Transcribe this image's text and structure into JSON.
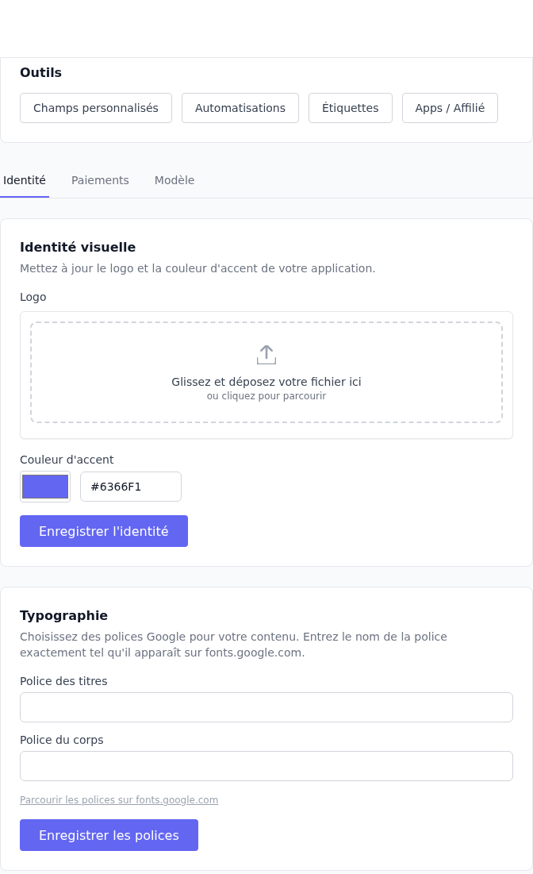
{
  "tools": {
    "title": "Outils",
    "buttons": [
      "Champs personnalisés",
      "Automatisations",
      "Étiquettes",
      "Apps / Affilié"
    ]
  },
  "tabs": [
    {
      "label": "Identité",
      "selected": true
    },
    {
      "label": "Paiements",
      "selected": false
    },
    {
      "label": "Modèle",
      "selected": false
    }
  ],
  "identity": {
    "title": "Identité visuelle",
    "description": "Mettez à jour le logo et la couleur d'accent de votre application.",
    "logo": {
      "label": "Logo",
      "dropzone": {
        "text": "Glissez et déposez votre fichier ici",
        "hint": "ou cliquez pour parcourir"
      }
    },
    "accent": {
      "label": "Couleur d'accent",
      "color": "#6366f1",
      "value": "#6366F1"
    },
    "save_button": "Enregistrer l'identité"
  },
  "typography": {
    "title": "Typographie",
    "description": "Choisissez des polices Google pour votre contenu. Entrez le nom de la police exactement tel qu'il apparaît sur fonts.google.com.",
    "fields": [
      {
        "label": "Police des titres"
      },
      {
        "label": "Police du corps"
      }
    ],
    "link": "Parcourir les polices sur fonts.google.com",
    "save_button": "Enregistrer les polices"
  }
}
